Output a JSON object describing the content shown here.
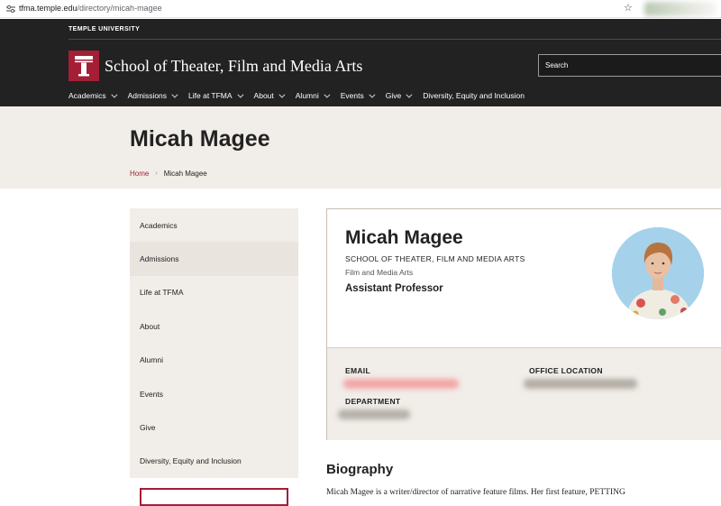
{
  "browser": {
    "url_host": "tfma.temple.edu",
    "url_path": "/directory/micah-magee"
  },
  "header": {
    "university": "TEMPLE UNIVERSITY",
    "school_name": "School of Theater, Film and Media Arts",
    "search_placeholder": "Search",
    "nav": [
      {
        "label": "Academics"
      },
      {
        "label": "Admissions"
      },
      {
        "label": "Life at TFMA"
      },
      {
        "label": "About"
      },
      {
        "label": "Alumni"
      },
      {
        "label": "Events"
      },
      {
        "label": "Give"
      },
      {
        "label": "Diversity, Equity and Inclusion"
      }
    ]
  },
  "hero": {
    "title": "Micah Magee",
    "breadcrumb": {
      "home": "Home",
      "separator": "›",
      "current": "Micah Magee"
    }
  },
  "sidebar": {
    "items": [
      {
        "label": "Academics"
      },
      {
        "label": "Admissions"
      },
      {
        "label": "Life at TFMA"
      },
      {
        "label": "About"
      },
      {
        "label": "Alumni"
      },
      {
        "label": "Events"
      },
      {
        "label": "Give"
      },
      {
        "label": "Diversity, Equity and Inclusion"
      }
    ]
  },
  "profile": {
    "name": "Micah Magee",
    "school": "SCHOOL OF THEATER, FILM AND MEDIA ARTS",
    "department": "Film and Media Arts",
    "title": "Assistant Professor",
    "labels": {
      "email": "EMAIL",
      "office": "OFFICE LOCATION",
      "department": "DEPARTMENT"
    }
  },
  "bio": {
    "heading": "Biography",
    "text": "Micah Magee is a writer/director of narrative feature films. Her first feature, PETTING"
  },
  "colors": {
    "brand_cherry": "#a41e35",
    "header_bg": "#222222",
    "sand_bg": "#f1ede8",
    "text": "#222222"
  },
  "icons": {
    "site_info": "tune-icon",
    "bookmark": "star-icon",
    "logo": "temple-t-logo",
    "nav_dropdown": "chevron-down-icon",
    "breadcrumb_separator": "chevron-right-icon"
  }
}
